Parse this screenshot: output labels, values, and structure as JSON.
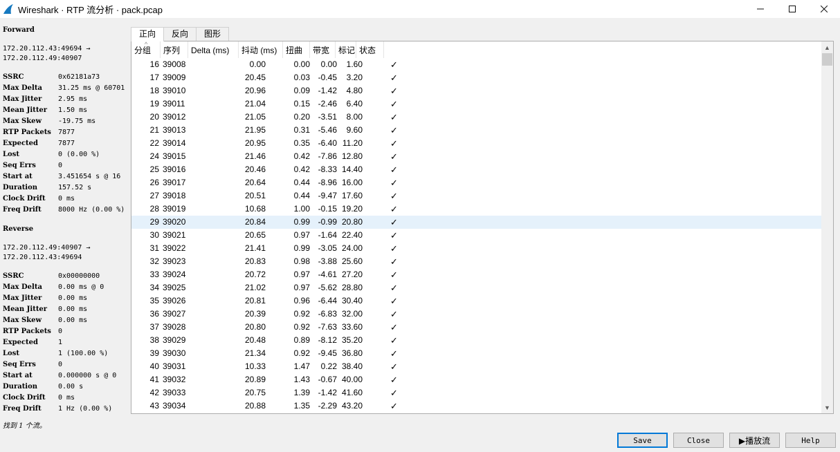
{
  "window": {
    "title": "Wireshark · RTP 流分析 · pack.pcap",
    "minimize_icon": "minimize-icon",
    "maximize_icon": "maximize-icon",
    "close_icon": "close-icon"
  },
  "forward": {
    "title": "Forward",
    "endpoint_line1": "172.20.112.43:49694 →",
    "endpoint_line2": "172.20.112.49:40907",
    "stats": [
      {
        "k": "SSRC",
        "v": "0x62181a73"
      },
      {
        "k": "Max Delta",
        "v": "31.25 ms @ 60701"
      },
      {
        "k": "Max Jitter",
        "v": "2.95 ms"
      },
      {
        "k": "Mean Jitter",
        "v": "1.50 ms"
      },
      {
        "k": "Max Skew",
        "v": "-19.75 ms"
      },
      {
        "k": "RTP Packets",
        "v": "7877"
      },
      {
        "k": "Expected",
        "v": "7877"
      },
      {
        "k": "Lost",
        "v": "0 (0.00 %)"
      },
      {
        "k": "Seq Errs",
        "v": "0"
      },
      {
        "k": "Start at",
        "v": "3.451654 s @ 16"
      },
      {
        "k": "Duration",
        "v": "157.52 s"
      },
      {
        "k": "Clock Drift",
        "v": "0 ms"
      },
      {
        "k": "Freq Drift",
        "v": "8000 Hz (0.00 %)"
      }
    ]
  },
  "reverse": {
    "title": "Reverse",
    "endpoint_line1": "172.20.112.49:40907 →",
    "endpoint_line2": "172.20.112.43:49694",
    "stats": [
      {
        "k": "SSRC",
        "v": "0x00000000"
      },
      {
        "k": "Max Delta",
        "v": "0.00 ms @ 0"
      },
      {
        "k": "Max Jitter",
        "v": "0.00 ms"
      },
      {
        "k": "Mean Jitter",
        "v": "0.00 ms"
      },
      {
        "k": "Max Skew",
        "v": "0.00 ms"
      },
      {
        "k": "RTP Packets",
        "v": "0"
      },
      {
        "k": "Expected",
        "v": "1"
      },
      {
        "k": "Lost",
        "v": "1 (100.00 %)"
      },
      {
        "k": "Seq Errs",
        "v": "0"
      },
      {
        "k": "Start at",
        "v": "0.000000 s @ 0"
      },
      {
        "k": "Duration",
        "v": "0.00 s"
      },
      {
        "k": "Clock Drift",
        "v": "0 ms"
      },
      {
        "k": "Freq Drift",
        "v": "1 Hz (0.00 %)"
      }
    ]
  },
  "tabs": [
    "正向",
    "反向",
    "图形"
  ],
  "active_tab": "正向",
  "table": {
    "headers": [
      "分组",
      "序列",
      "Delta (ms)",
      "抖动 (ms)",
      "扭曲",
      "带宽",
      "标记",
      "状态"
    ],
    "selected_row": "29",
    "rows": [
      [
        "16",
        "39008",
        "0.00",
        "0.00",
        "0.00",
        "1.60",
        "",
        "✓"
      ],
      [
        "17",
        "39009",
        "20.45",
        "0.03",
        "-0.45",
        "3.20",
        "",
        "✓"
      ],
      [
        "18",
        "39010",
        "20.96",
        "0.09",
        "-1.42",
        "4.80",
        "",
        "✓"
      ],
      [
        "19",
        "39011",
        "21.04",
        "0.15",
        "-2.46",
        "6.40",
        "",
        "✓"
      ],
      [
        "20",
        "39012",
        "21.05",
        "0.20",
        "-3.51",
        "8.00",
        "",
        "✓"
      ],
      [
        "21",
        "39013",
        "21.95",
        "0.31",
        "-5.46",
        "9.60",
        "",
        "✓"
      ],
      [
        "22",
        "39014",
        "20.95",
        "0.35",
        "-6.40",
        "11.20",
        "",
        "✓"
      ],
      [
        "24",
        "39015",
        "21.46",
        "0.42",
        "-7.86",
        "12.80",
        "",
        "✓"
      ],
      [
        "25",
        "39016",
        "20.46",
        "0.42",
        "-8.33",
        "14.40",
        "",
        "✓"
      ],
      [
        "26",
        "39017",
        "20.64",
        "0.44",
        "-8.96",
        "16.00",
        "",
        "✓"
      ],
      [
        "27",
        "39018",
        "20.51",
        "0.44",
        "-9.47",
        "17.60",
        "",
        "✓"
      ],
      [
        "28",
        "39019",
        "10.68",
        "1.00",
        "-0.15",
        "19.20",
        "",
        "✓"
      ],
      [
        "29",
        "39020",
        "20.84",
        "0.99",
        "-0.99",
        "20.80",
        "",
        "✓"
      ],
      [
        "30",
        "39021",
        "20.65",
        "0.97",
        "-1.64",
        "22.40",
        "",
        "✓"
      ],
      [
        "31",
        "39022",
        "21.41",
        "0.99",
        "-3.05",
        "24.00",
        "",
        "✓"
      ],
      [
        "32",
        "39023",
        "20.83",
        "0.98",
        "-3.88",
        "25.60",
        "",
        "✓"
      ],
      [
        "33",
        "39024",
        "20.72",
        "0.97",
        "-4.61",
        "27.20",
        "",
        "✓"
      ],
      [
        "34",
        "39025",
        "21.02",
        "0.97",
        "-5.62",
        "28.80",
        "",
        "✓"
      ],
      [
        "35",
        "39026",
        "20.81",
        "0.96",
        "-6.44",
        "30.40",
        "",
        "✓"
      ],
      [
        "36",
        "39027",
        "20.39",
        "0.92",
        "-6.83",
        "32.00",
        "",
        "✓"
      ],
      [
        "37",
        "39028",
        "20.80",
        "0.92",
        "-7.63",
        "33.60",
        "",
        "✓"
      ],
      [
        "38",
        "39029",
        "20.48",
        "0.89",
        "-8.12",
        "35.20",
        "",
        "✓"
      ],
      [
        "39",
        "39030",
        "21.34",
        "0.92",
        "-9.45",
        "36.80",
        "",
        "✓"
      ],
      [
        "40",
        "39031",
        "10.33",
        "1.47",
        "0.22",
        "38.40",
        "",
        "✓"
      ],
      [
        "41",
        "39032",
        "20.89",
        "1.43",
        "-0.67",
        "40.00",
        "",
        "✓"
      ],
      [
        "42",
        "39033",
        "20.75",
        "1.39",
        "-1.42",
        "41.60",
        "",
        "✓"
      ],
      [
        "43",
        "39034",
        "20.88",
        "1.35",
        "-2.29",
        "43.20",
        "",
        "✓"
      ]
    ]
  },
  "status": "找到 1 个流。",
  "buttons": {
    "save": "Save",
    "close": "Close",
    "play": "▶播放流",
    "help": "Help"
  }
}
